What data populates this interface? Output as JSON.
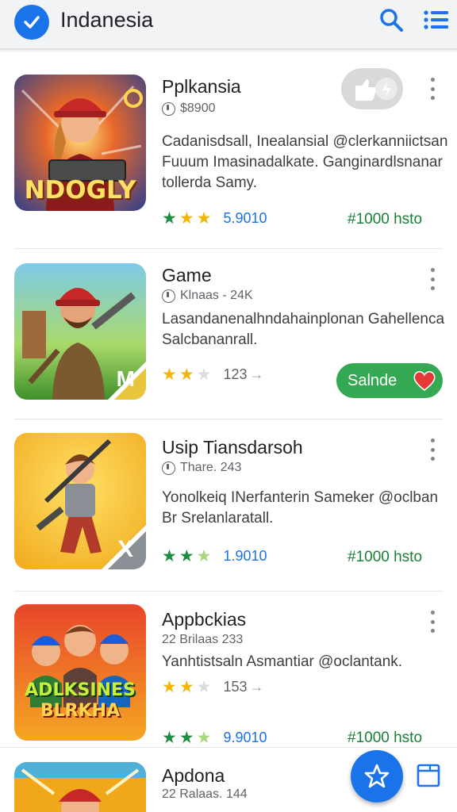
{
  "header": {
    "title": "Indanesia",
    "brand_icon": "checkmark-badge-icon",
    "search_icon": "search-icon",
    "menu_icon": "list-menu-icon",
    "accent": "#1a73e8"
  },
  "apps": [
    {
      "title": "Pplkansia",
      "meta": "$8900",
      "description": "Cadanisdsall, Inealansial @clerkanniictsan Fuuum Imasinadalkate. Ganginardlsnanar tollerda Samy.",
      "stars": 3,
      "rating": "5.9010",
      "price": "#1000 hsto",
      "thumb_text": "NDOGLY",
      "action": "favorite-toggle"
    },
    {
      "title": "Game",
      "meta": "Klnaas - 24K",
      "description": "Lasandanenalhndahainplonan Gahellenca Salcbananrall.",
      "stars": 2,
      "rating": "123",
      "price": "",
      "thumb_badge": "M",
      "action_label": "Salnde"
    },
    {
      "title": "Usip Tiansdarsoh",
      "meta": "Thare. 243",
      "description": "Yonolkeiq INerfanterin Sameker @oclban Br Srelanlaratall.",
      "stars": 2.5,
      "rating": "1.9010",
      "price": "#1000 hsto",
      "thumb_badge": "X"
    },
    {
      "title": "Appbckias",
      "meta": "22 Brilaas  233",
      "description": "Yanhtistsaln Asmantiar @oclantank.",
      "stars": 2,
      "rating": "153",
      "rating2_stars": 2.5,
      "rating2": "9.9010",
      "price": "#1000 hsto",
      "thumb_text_top": "ADLKSINES",
      "thumb_text_bottom": "BLRKHA"
    },
    {
      "title": "Apdona",
      "meta": "22 Ralaas. 144"
    }
  ],
  "fab_icon": "star-outline-icon",
  "corner_icon": "window-icon",
  "colors": {
    "star_filled": "#f2b705",
    "star_green": "#1e8e3e",
    "star_empty": "#dadce0",
    "price": "#188038",
    "install": "#34a853"
  }
}
